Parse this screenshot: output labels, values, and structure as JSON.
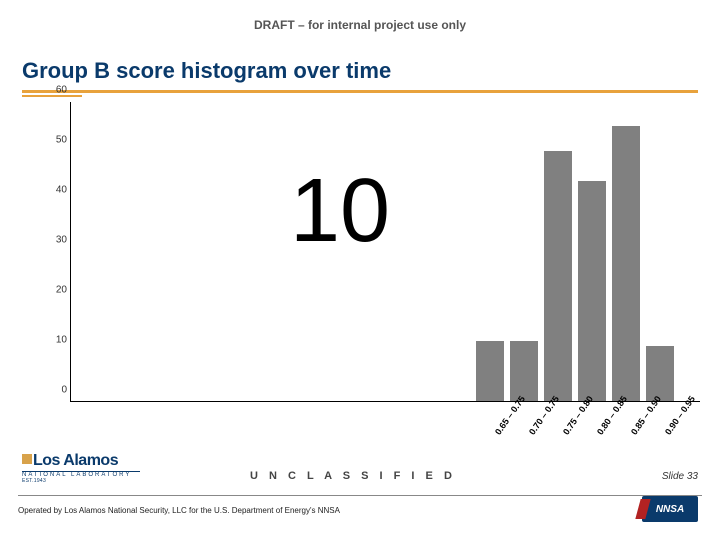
{
  "banner": "DRAFT – for internal project use only",
  "title": "Group B score histogram over time",
  "overlay_number": "10",
  "classification": "U N C L A S S I F I E D",
  "footer_operated": "Operated by Los Alamos National Security, LLC for the U.S. Department of Energy's NNSA",
  "slide_number": "Slide 33",
  "logo_lanl": {
    "name": "Los Alamos",
    "line1": "NATIONAL LABORATORY",
    "line2": "EST.1943"
  },
  "logo_nnsa": "NNSA",
  "chart_data": {
    "type": "bar",
    "title": "Group B score histogram over time",
    "xlabel": "",
    "ylabel": "",
    "ylim": [
      0,
      60
    ],
    "yticks": [
      0,
      10,
      20,
      30,
      40,
      50,
      60
    ],
    "categories": [
      "0.65 – 0.75",
      "0.70 – 0.75",
      "0.75 – 0.80",
      "0.80 – 0.85",
      "0.85 – 0.90",
      "0.90 – 0.95"
    ],
    "values": [
      12,
      12,
      50,
      44,
      55,
      11
    ]
  }
}
